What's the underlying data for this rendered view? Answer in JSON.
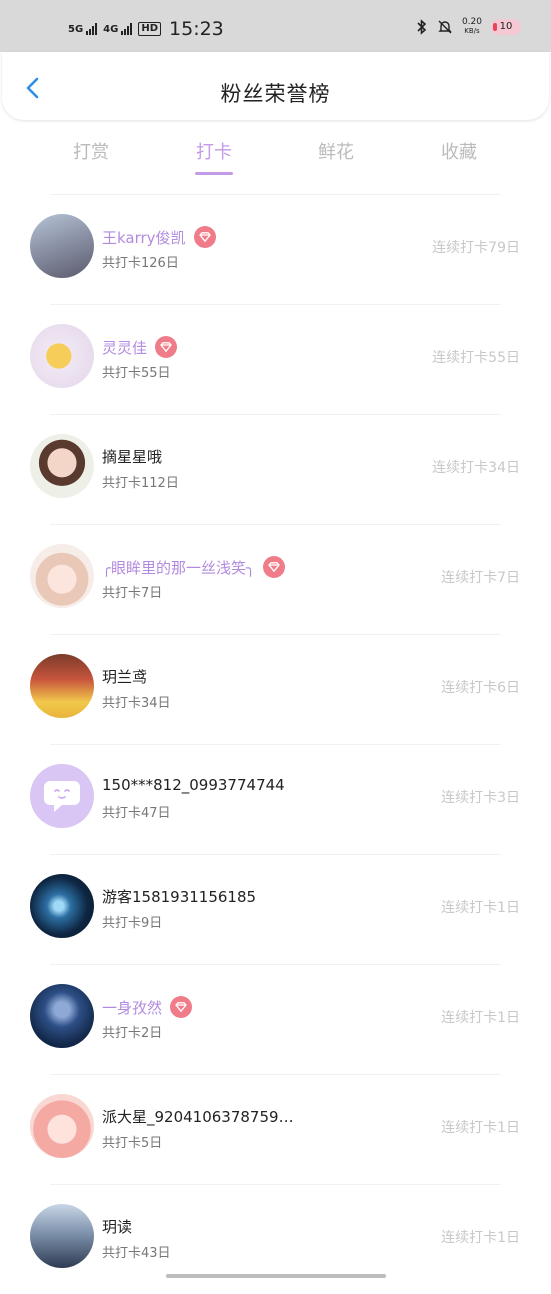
{
  "status_bar": {
    "net1": "5G",
    "net2": "4G",
    "hd": "HD",
    "time": "15:23",
    "speed_value": "0.20",
    "speed_unit": "KB/s",
    "battery": "10"
  },
  "header": {
    "title": "粉丝荣誉榜"
  },
  "tabs": [
    {
      "label": "打赏"
    },
    {
      "label": "打卡"
    },
    {
      "label": "鲜花"
    },
    {
      "label": "收藏"
    }
  ],
  "active_tab": "打卡",
  "fans": [
    {
      "name": "王karry俊凯",
      "total": "共打卡126日",
      "streak": "连续打卡79日",
      "vip": true
    },
    {
      "name": "灵灵佳",
      "total": "共打卡55日",
      "streak": "连续打卡55日",
      "vip": true
    },
    {
      "name": "摘星星哦",
      "total": "共打卡112日",
      "streak": "连续打卡34日",
      "vip": false
    },
    {
      "name": "╭眼眸里的那一丝浅笑╮",
      "total": "共打卡7日",
      "streak": "连续打卡7日",
      "vip": true
    },
    {
      "name": "玥兰鸢",
      "total": "共打卡34日",
      "streak": "连续打卡6日",
      "vip": false
    },
    {
      "name": "150***812_0993774744",
      "total": "共打卡47日",
      "streak": "连续打卡3日",
      "vip": false
    },
    {
      "name": "游客1581931156185",
      "total": "共打卡9日",
      "streak": "连续打卡1日",
      "vip": false
    },
    {
      "name": "一身孜然",
      "total": "共打卡2日",
      "streak": "连续打卡1日",
      "vip": true
    },
    {
      "name": "派大星_9204106378759…",
      "total": "共打卡5日",
      "streak": "连续打卡1日",
      "vip": false
    },
    {
      "name": "玥读",
      "total": "共打卡43日",
      "streak": "连续打卡1日",
      "vip": false
    }
  ],
  "colors": {
    "accent": "#c49be6",
    "vip_name": "#b28be0",
    "gem": "#f07c89",
    "back_arrow": "#2f8fe8"
  }
}
